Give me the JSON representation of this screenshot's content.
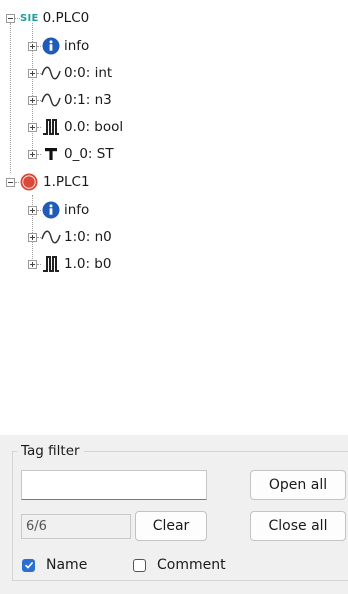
{
  "tree": {
    "plc0": {
      "badge": "SIE",
      "label": "0.PLC0",
      "children": [
        {
          "icon": "info-icon",
          "label": "info"
        },
        {
          "icon": "analog-wave-icon",
          "label": "0:0: int"
        },
        {
          "icon": "analog-wave-icon",
          "label": "0:1: n3"
        },
        {
          "icon": "digital-pulse-icon",
          "label": "0.0: bool"
        },
        {
          "icon": "struct-t-icon",
          "label": "0_0: ST"
        }
      ]
    },
    "plc1": {
      "badge": "RA",
      "label": "1.PLC1",
      "children": [
        {
          "icon": "info-icon",
          "label": "info"
        },
        {
          "icon": "analog-wave-icon",
          "label": "1:0: n0"
        },
        {
          "icon": "digital-pulse-icon",
          "label": "1.0: b0"
        }
      ]
    }
  },
  "filter": {
    "legend": "Tag filter",
    "input_value": "",
    "count": "6/6",
    "open_all": "Open all",
    "clear": "Clear",
    "close_all": "Close all",
    "name_label": "Name",
    "name_checked": true,
    "comment_label": "Comment",
    "comment_checked": false
  },
  "colors": {
    "info_blue": "#1f5bb8",
    "ra_red": "#d94a3a",
    "sie_teal": "#1aa39b",
    "checkbox_blue": "#2a6fd1"
  }
}
